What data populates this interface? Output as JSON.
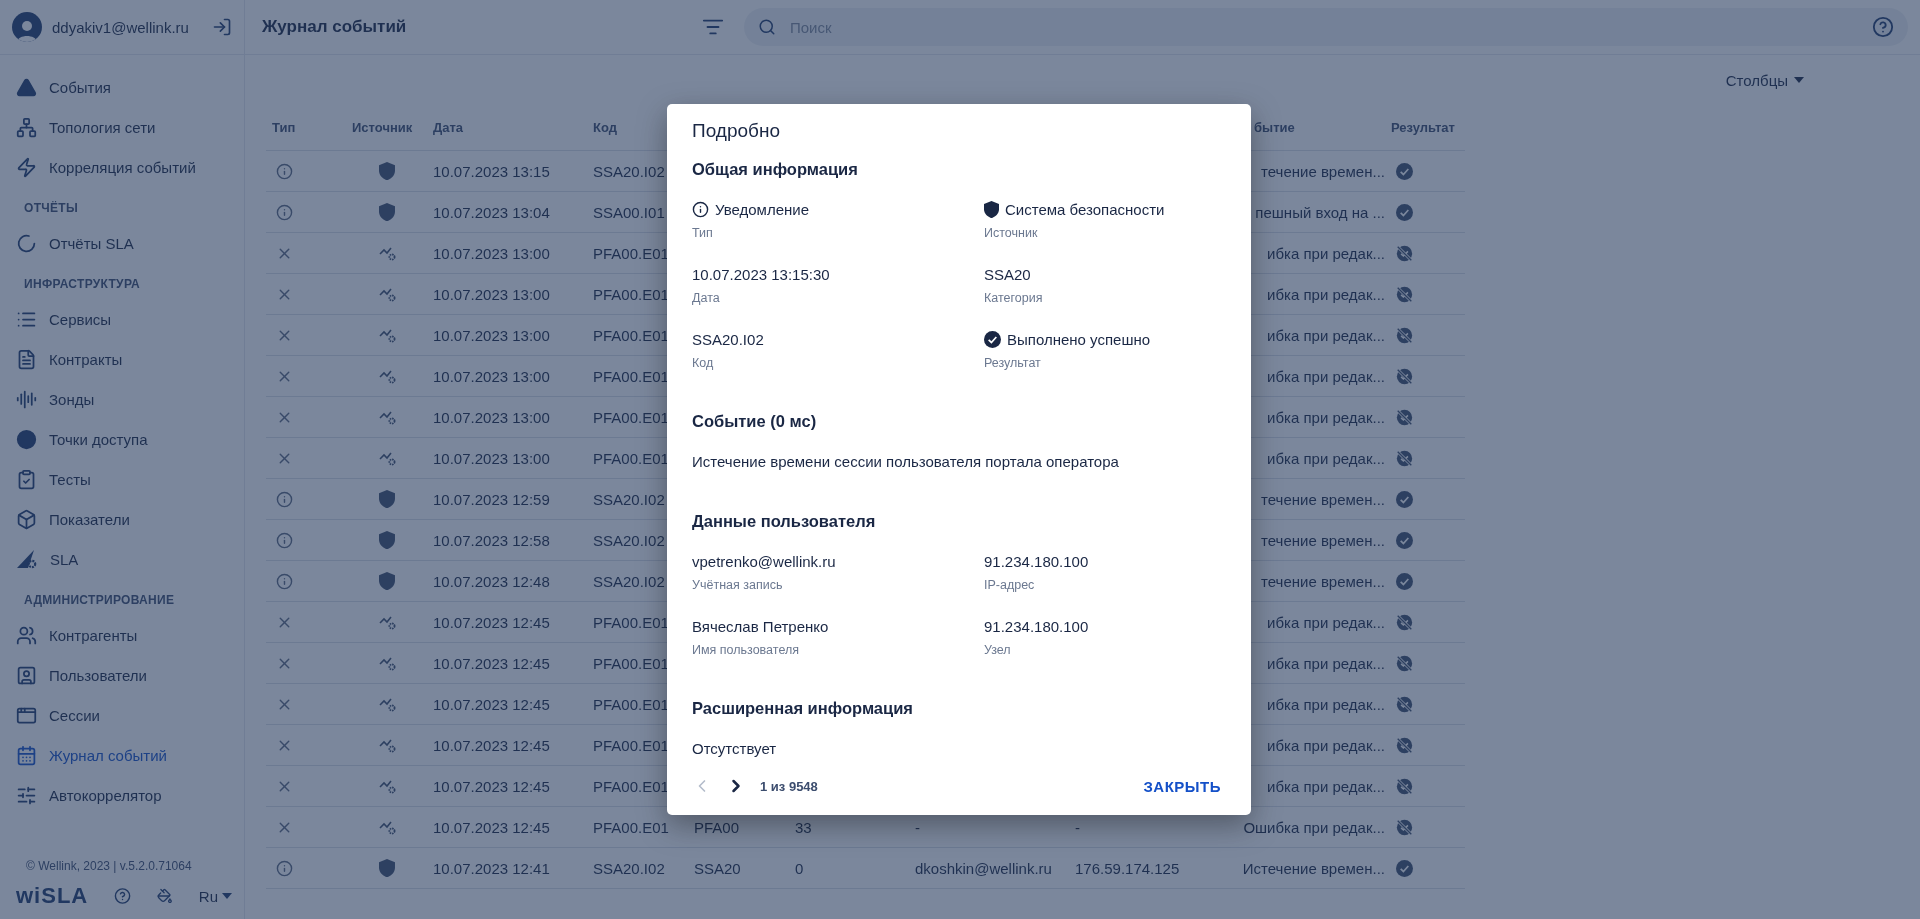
{
  "sidebar": {
    "user": "ddyakiv1@wellink.ru",
    "sections": [
      {
        "items": [
          {
            "label": "События",
            "selected": false
          },
          {
            "label": "Топология сети",
            "selected": false
          },
          {
            "label": "Корреляция событий",
            "selected": false
          }
        ]
      },
      {
        "title": "ОТЧЁТЫ",
        "items": [
          {
            "label": "Отчёты SLA",
            "selected": false
          }
        ]
      },
      {
        "title": "ИНФРАСТРУКТУРА",
        "items": [
          {
            "label": "Сервисы",
            "selected": false
          },
          {
            "label": "Контракты",
            "selected": false
          },
          {
            "label": "Зонды",
            "selected": false
          },
          {
            "label": "Точки доступа",
            "selected": false
          },
          {
            "label": "Тесты",
            "selected": false
          },
          {
            "label": "Показатели",
            "selected": false
          },
          {
            "label": "SLA",
            "selected": false
          }
        ]
      },
      {
        "title": "АДМИНИСТРИРОВАНИЕ",
        "items": [
          {
            "label": "Контрагенты",
            "selected": false
          },
          {
            "label": "Пользователи",
            "selected": false
          },
          {
            "label": "Сессии",
            "selected": false
          },
          {
            "label": "Журнал событий",
            "selected": true
          },
          {
            "label": "Автокоррелятор",
            "selected": false
          }
        ]
      }
    ],
    "copyright": "© Wellink, 2023 | v.5.2.0.71064",
    "logo": "wiSLA",
    "language": "Ru"
  },
  "header": {
    "title": "Журнал событий",
    "search": {
      "placeholder": "Поиск"
    }
  },
  "columns_button": "Столбцы",
  "table": {
    "columns": [
      "Тип",
      "Источник",
      "Дата",
      "Код",
      "бытие",
      "Результат"
    ],
    "rows": [
      {
        "kind": "info",
        "security_source": true,
        "date": "10.07.2023 13:15",
        "code": "SSA20.I02",
        "event": "течение времен...",
        "success": true
      },
      {
        "kind": "info",
        "security_source": true,
        "date": "10.07.2023 13:04",
        "code": "SSA00.I01",
        "event": "пешный вход на ...",
        "success": true
      },
      {
        "kind": "error",
        "security_source": false,
        "date": "10.07.2023 13:00",
        "code": "PFA00.E01",
        "event": "ибка при редак...",
        "success": false
      },
      {
        "kind": "error",
        "security_source": false,
        "date": "10.07.2023 13:00",
        "code": "PFA00.E01",
        "event": "ибка при редак...",
        "success": false
      },
      {
        "kind": "error",
        "security_source": false,
        "date": "10.07.2023 13:00",
        "code": "PFA00.E01",
        "event": "ибка при редак...",
        "success": false
      },
      {
        "kind": "error",
        "security_source": false,
        "date": "10.07.2023 13:00",
        "code": "PFA00.E01",
        "event": "ибка при редак...",
        "success": false
      },
      {
        "kind": "error",
        "security_source": false,
        "date": "10.07.2023 13:00",
        "code": "PFA00.E01",
        "event": "ибка при редак...",
        "success": false
      },
      {
        "kind": "error",
        "security_source": false,
        "date": "10.07.2023 13:00",
        "code": "PFA00.E01",
        "event": "ибка при редак...",
        "success": false
      },
      {
        "kind": "info",
        "security_source": true,
        "date": "10.07.2023 12:59",
        "code": "SSA20.I02",
        "event": "течение времен...",
        "success": true
      },
      {
        "kind": "info",
        "security_source": true,
        "date": "10.07.2023 12:58",
        "code": "SSA20.I02",
        "event": "течение времен...",
        "success": true
      },
      {
        "kind": "info",
        "security_source": true,
        "date": "10.07.2023 12:48",
        "code": "SSA20.I02",
        "event": "течение времен...",
        "success": true
      },
      {
        "kind": "error",
        "security_source": false,
        "date": "10.07.2023 12:45",
        "code": "PFA00.E01",
        "event": "ибка при редак...",
        "success": false
      },
      {
        "kind": "error",
        "security_source": false,
        "date": "10.07.2023 12:45",
        "code": "PFA00.E01",
        "event": "ибка при редак...",
        "success": false
      },
      {
        "kind": "error",
        "security_source": false,
        "date": "10.07.2023 12:45",
        "code": "PFA00.E01",
        "event": "ибка при редак...",
        "success": false
      },
      {
        "kind": "error",
        "security_source": false,
        "date": "10.07.2023 12:45",
        "code": "PFA00.E01",
        "event": "ибка при редак...",
        "success": false
      },
      {
        "kind": "error",
        "security_source": false,
        "date": "10.07.2023 12:45",
        "code": "PFA00.E01",
        "event": "ибка при редак...",
        "success": false
      },
      {
        "kind": "error",
        "security_source": false,
        "date": "10.07.2023 12:45",
        "code": "PFA00.E01",
        "category": "PFA00",
        "duration": "33",
        "user": "-",
        "ip": "-",
        "event": "Ошибка при редак...",
        "success": false
      },
      {
        "kind": "info",
        "security_source": true,
        "date": "10.07.2023 12:41",
        "code": "SSA20.I02",
        "category": "SSA20",
        "duration": "0",
        "user": "dkoshkin@wellink.ru",
        "ip": "176.59.174.125",
        "event": "Истечение времен...",
        "success": true
      }
    ]
  },
  "dialog": {
    "title": "Подробно",
    "sections": [
      {
        "heading": "Общая информация",
        "fields": [
          {
            "kind": "info",
            "value": "Уведомление",
            "label": "Тип"
          },
          {
            "kind": "security",
            "value": "Система безопасности",
            "label": "Источник"
          },
          {
            "kind": "plain",
            "value": "10.07.2023 13:15:30",
            "label": "Дата"
          },
          {
            "kind": "plain",
            "value": "SSA20",
            "label": "Категория"
          },
          {
            "kind": "plain",
            "value": "SSA20.I02",
            "label": "Код"
          },
          {
            "kind": "success",
            "value": "Выполнено успешно",
            "label": "Результат"
          }
        ]
      },
      {
        "heading": "Событие (0 мс)",
        "text": "Истечение времени сессии пользователя портала оператора"
      },
      {
        "heading": "Данные пользователя",
        "fields": [
          {
            "kind": "plain",
            "value": "vpetrenko@wellink.ru",
            "label": "Учётная запись"
          },
          {
            "kind": "plain",
            "value": "91.234.180.100",
            "label": "IP-адрес"
          },
          {
            "kind": "plain",
            "value": "Вячеслав Петренко",
            "label": "Имя пользователя"
          },
          {
            "kind": "plain",
            "value": "91.234.180.100",
            "label": "Узел"
          }
        ]
      },
      {
        "heading": "Расширенная информация",
        "text": "Отсутствует"
      }
    ],
    "pager": {
      "prev_disabled": true,
      "next_disabled": false,
      "text": "1 из 9548"
    },
    "close": "ЗАКРЫТЬ"
  }
}
